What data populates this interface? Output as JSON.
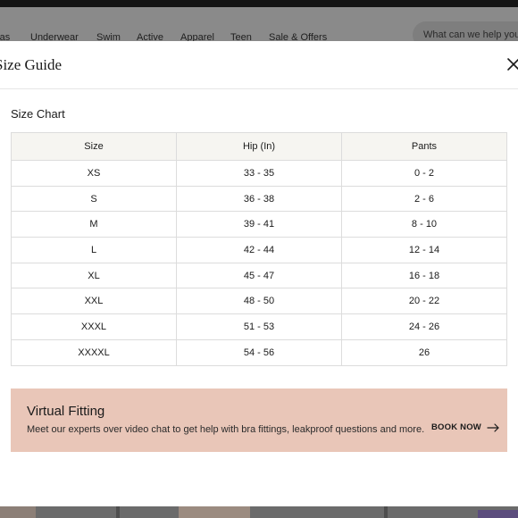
{
  "background_nav": {
    "items": [
      "ras",
      "Underwear",
      "Swim",
      "Active",
      "Apparel",
      "Teen",
      "Sale & Offers"
    ],
    "search_placeholder": "What can we help you"
  },
  "modal": {
    "title": "Size Guide",
    "close_icon": "close-icon",
    "chart_heading": "Size Chart",
    "table": {
      "columns": [
        "Size",
        "Hip (In)",
        "Pants"
      ],
      "rows": [
        [
          "XS",
          "33 - 35",
          "0 - 2"
        ],
        [
          "S",
          "36 - 38",
          "2 - 6"
        ],
        [
          "M",
          "39 - 41",
          "8 - 10"
        ],
        [
          "L",
          "42 - 44",
          "12 - 14"
        ],
        [
          "XL",
          "45 - 47",
          "16 - 18"
        ],
        [
          "XXL",
          "48 - 50",
          "20 - 22"
        ],
        [
          "XXXL",
          "51 - 53",
          "24 - 26"
        ],
        [
          "XXXXL",
          "54 - 56",
          "26"
        ]
      ]
    },
    "virtual_fitting": {
      "title": "Virtual Fitting",
      "description": "Meet our experts over video chat to get help with bra fittings, leakproof questions and more.",
      "cta_label": "BOOK NOW",
      "cta_icon": "arrow-right-icon",
      "background_color": "#e9c6b8"
    }
  }
}
